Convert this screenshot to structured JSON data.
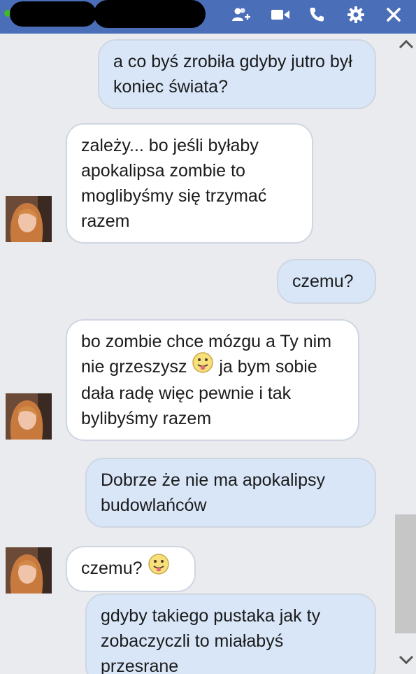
{
  "header": {
    "icons": [
      "add-person-icon",
      "video-call-icon",
      "phone-icon",
      "gear-icon",
      "close-icon"
    ],
    "accent_color": "#4a6eb8",
    "online_color": "#42b72a"
  },
  "messages": [
    {
      "direction": "outgoing",
      "text": "a co byś zrobiła gdyby jutro był koniec świata?"
    },
    {
      "direction": "incoming",
      "text": "zależy... bo jeśli byłaby apokalipsa zombie to moglibyśmy się trzymać razem"
    },
    {
      "direction": "outgoing",
      "text": "czemu?"
    },
    {
      "direction": "incoming",
      "text_before_emoji": "bo zombie chce mózgu a Ty nim nie grzeszysz",
      "text_after_emoji": "ja bym sobie dała radę więc pewnie i tak bylibyśmy razem",
      "emoji": "tongue-out-emoji"
    },
    {
      "direction": "outgoing",
      "text": "Dobrze że nie ma apokalipsy budowlańców"
    },
    {
      "direction": "incoming",
      "text": "czemu?",
      "emoji": "tongue-out-emoji"
    },
    {
      "direction": "outgoing",
      "text": "gdyby takiego pustaka  jak ty zobaczyczli to miałabyś przesrane"
    }
  ]
}
